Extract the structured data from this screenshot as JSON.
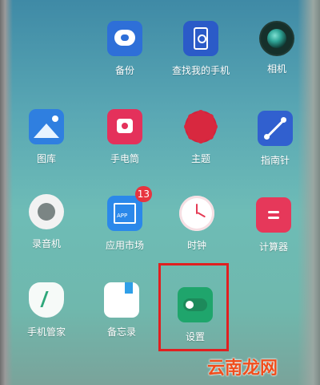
{
  "apps": [
    {
      "id": "backup",
      "label": "备份"
    },
    {
      "id": "find-phone",
      "label": "查找我的手机"
    },
    {
      "id": "camera",
      "label": "相机"
    },
    {
      "id": "gallery",
      "label": "图库"
    },
    {
      "id": "flashlight",
      "label": "手电筒"
    },
    {
      "id": "theme",
      "label": "主题"
    },
    {
      "id": "compass",
      "label": "指南针"
    },
    {
      "id": "recorder",
      "label": "录音机"
    },
    {
      "id": "app-market",
      "label": "应用市场",
      "badge": "13"
    },
    {
      "id": "clock",
      "label": "时钟"
    },
    {
      "id": "calculator",
      "label": "计算器"
    },
    {
      "id": "phone-manager",
      "label": "手机管家"
    },
    {
      "id": "notes",
      "label": "备忘录"
    },
    {
      "id": "settings",
      "label": "设置"
    }
  ],
  "highlight_target": "settings",
  "watermark": "云南龙网",
  "colors": {
    "highlight_border": "#e02020",
    "badge": "#e8343f",
    "watermark": "#f04e1d"
  }
}
